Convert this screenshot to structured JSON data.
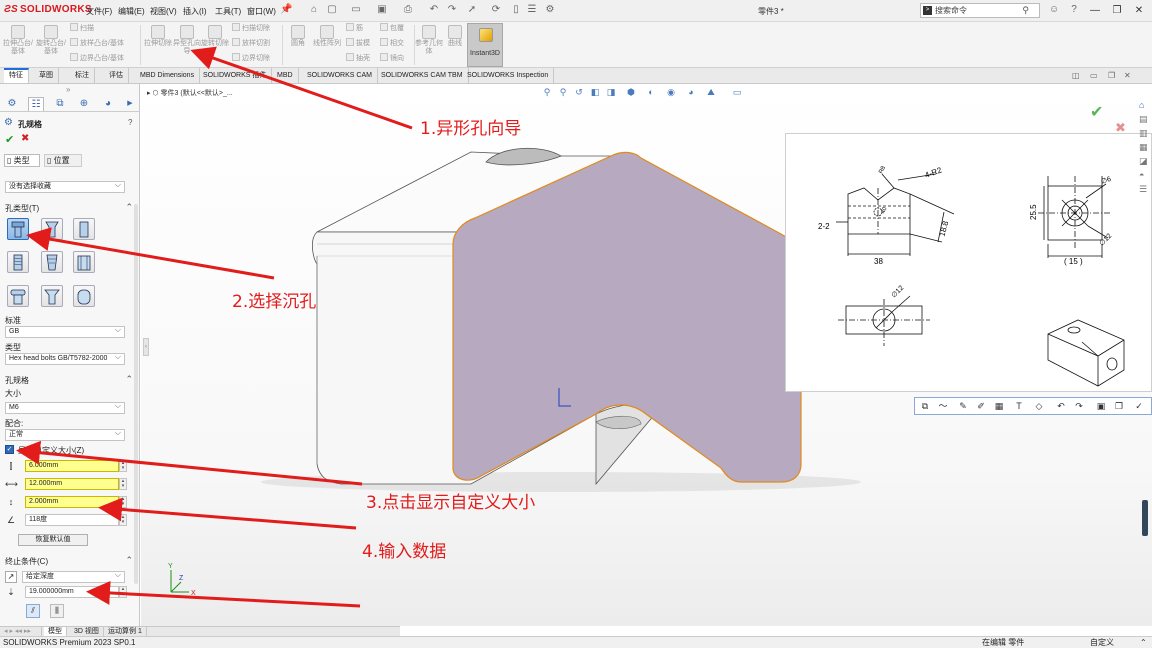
{
  "app": {
    "logo_brand": "SOLIDWORKS",
    "menu": [
      "文件(F)",
      "编辑(E)",
      "视图(V)",
      "插入(I)",
      "工具(T)",
      "窗口(W)"
    ],
    "doc_title": "零件3 *",
    "search_placeholder": "搜索命令",
    "status_product": "SOLIDWORKS Premium 2023 SP0.1",
    "status_mode": "在编辑 零件",
    "status_custom": "自定义"
  },
  "ribbon": {
    "extrude_boss": "拉伸凸台/基体",
    "revolve_boss": "旋转凸台/基体",
    "sweep": "扫描",
    "loft": "放样凸台/基体",
    "boundary": "边界凸台/基体",
    "extrude_cut": "拉伸切除",
    "hole_wizard": "异型孔向导",
    "revolve_cut": "旋转切除",
    "swept_cut": "扫描切除",
    "lofted_cut": "放样切割",
    "boundary_cut": "边界切除",
    "fillet": "圆角",
    "linear_pattern": "线性阵列",
    "rib": "筋",
    "draft": "拔模",
    "shell": "抽壳",
    "wrap": "包覆",
    "intersect": "相交",
    "mirror": "镜向",
    "ref_geometry": "参考几何体",
    "curves": "曲线",
    "instant3d": "Instant3D"
  },
  "tabs": [
    "特征",
    "草图",
    "标注",
    "评估",
    "MBD Dimensions",
    "SOLIDWORKS 插件",
    "MBD",
    "SOLIDWORKS CAM",
    "SOLIDWORKS CAM TBM",
    "SOLIDWORKS Inspection"
  ],
  "panel": {
    "title": "孔规格",
    "type_tab": "类型",
    "position_tab": "位置",
    "fav_combo": "没有选择收藏",
    "hole_type_section": "孔类型(T)",
    "standard_label": "标准",
    "standard_value": "GB",
    "type_label": "类型",
    "type_value": "Hex head bolts GB/T5782-2000",
    "spec_section": "孔规格",
    "size_label": "大小",
    "size_value": "M6",
    "fit_label": "配合:",
    "fit_value": "正常",
    "custom_size_label": "显示自定义大小(Z)",
    "dim1": "6.000mm",
    "dim2": "12.000mm",
    "dim3": "2.000mm",
    "angle": "118度",
    "restore_default": "恢复默认值",
    "end_condition_section": "终止条件(C)",
    "end_condition_value": "给定深度",
    "depth_value": "19.000000mm"
  },
  "bottom_tabs": [
    "模型",
    "3D 视图",
    "运动算例 1"
  ],
  "graphics": {
    "breadcrumb": "零件3 (默认<<默认>_..."
  },
  "drawing": {
    "dim_38": "38",
    "dim_188": "18.8",
    "dim_255": "25.5",
    "dim_15": "( 15 )",
    "dim_4r2": "4-R2",
    "dim_22": "2-2",
    "dim_r8": "R8",
    "dim_40": "40",
    "dim_6": "∅6",
    "dim_12": "∅12",
    "dim_12b": "∅12"
  },
  "annotations": {
    "a1": "1.异形孔向导",
    "a2": "2.选择沉孔",
    "a3": "3.点击显示自定义大小",
    "a4": "4.输入数据"
  },
  "colors": {
    "annotation": "#e21b1b",
    "face_selected": "#b7a9c0",
    "edge_highlight": "#e08a1a",
    "tab_active_accent": "#1e6fd9"
  }
}
